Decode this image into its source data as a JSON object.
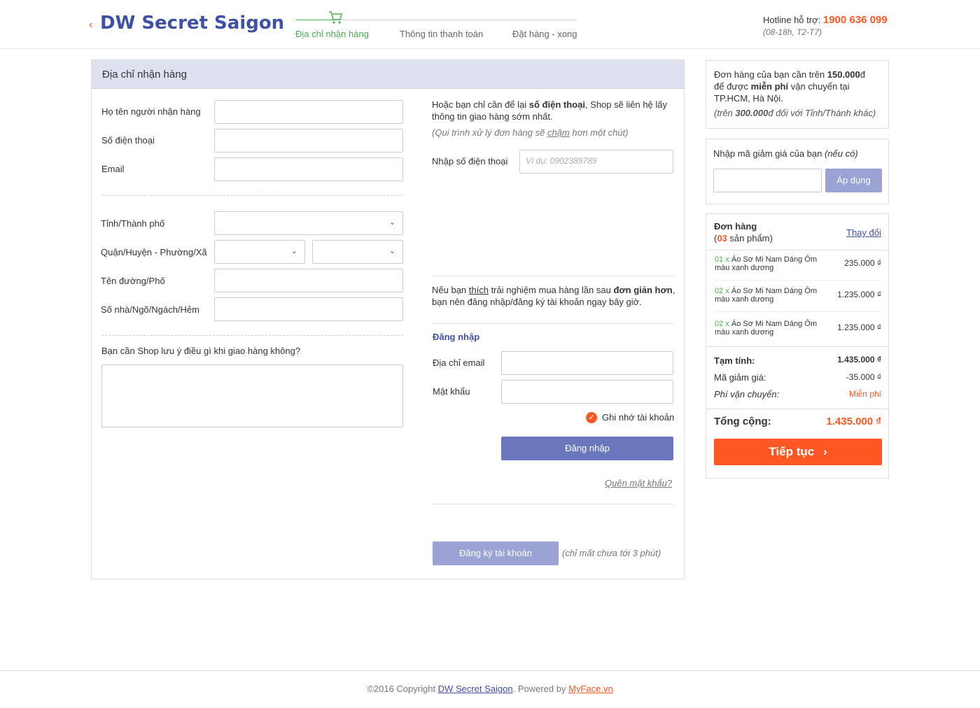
{
  "header": {
    "brand": "DW Secret Saigon",
    "steps": [
      "Địa chỉ nhận hàng",
      "Thông tin thanh toán",
      "Đặt hàng - xong"
    ],
    "hotline_label": "Hotline hỗ trợ:",
    "hotline_number": "1900 636 099",
    "hotline_hours": "(08-18h, T2-T7)"
  },
  "address_section": {
    "title": "Địa chỉ nhận hàng",
    "fields": {
      "name_label": "Họ tên người nhận hàng",
      "phone_label": "Số điện thoại",
      "email_label": "Email",
      "city_label": "Tỉnh/Thành phố",
      "district_label": "Quận/Huyện - Phường/Xã",
      "street_label": "Tên đường/Phố",
      "house_label": "Số nhà/Ngõ/Ngách/Hẻm",
      "note_label": "Bạn cần Shop lưu ý điều gì khi giao hàng không?"
    }
  },
  "quick_phone": {
    "intro_1": "Hoặc bạn chỉ cần để lại ",
    "intro_bold": "số điện thoại",
    "intro_2": ", Shop sẽ liên hệ lấy thông tin giao hàng sớm nhất.",
    "note_1": "(Qui trình xử lý đơn hàng sẽ ",
    "note_u": "chậm",
    "note_2": " hơn một chút)",
    "phone_label": "Nhập số  điện thoại",
    "phone_placeholder": "Ví dụ: 0902389789"
  },
  "login_section": {
    "intro_1": "Nếu bạn ",
    "intro_u": "thích",
    "intro_2": " trải nghiệm mua hàng lần sau ",
    "intro_bold": "đơn giản hơn",
    "intro_3": ",",
    "intro_4": "bạn nên đăng nhập/đăng ký tài khoản ngay bây giờ.",
    "title": "Đăng nhập",
    "email_label": "Địa chỉ email",
    "password_label": "Mật khẩu",
    "remember_label": "Ghi nhớ tài khoản",
    "login_button": "Đăng nhập",
    "forgot_link": "Quên mật khẩu?",
    "register_button": "Đăng ký tài khoản",
    "register_note": "(chỉ mất chưa tới 3 phút)"
  },
  "shipping_info": {
    "line1_a": "Đơn hàng của bạn cần trên ",
    "line1_bold": "150.000",
    "line1_cur": "đ",
    "line2_a": "để được ",
    "line2_bold": "miễn phí",
    "line2_b": " vận chuyển tại",
    "line3": "TP.HCM, Hà Nội.",
    "line4_a": "(trên ",
    "line4_bold": "300.000",
    "line4_b": "đ đối với Tỉnh/Thành khác)"
  },
  "coupon": {
    "label": "Nhập mã giảm giá của bạn ",
    "label_ital": "(nếu có)",
    "apply_button": "Áp dụng"
  },
  "order": {
    "title": "Đơn hàng",
    "count_prefix": "(",
    "count": "03",
    "count_suffix": " sản phẩm)",
    "change_link": "Thay đổi",
    "items": [
      {
        "qty": "01 x",
        "name_1": "Áo Sơ Mi Nam Dáng Ôm",
        "name_2": "màu xanh dương",
        "price": "235.000 ₫"
      },
      {
        "qty": "02 x",
        "name_1": "Áo Sơ Mi Nam Dáng Ôm",
        "name_2": "màu xanh dương",
        "price": "1.235.000 ₫"
      },
      {
        "qty": "02 x",
        "name_1": "Áo Sơ Mi Nam Dáng Ôm",
        "name_2": "màu xanh dương",
        "price": "1.235.000 ₫"
      }
    ],
    "subtotal_label": "Tạm tính:",
    "subtotal_value": "1.435.000 ₫",
    "discount_label": "Mã giảm giá:",
    "discount_value": "-35.000 ₫",
    "shipping_label": "Phí vận chuyển:",
    "shipping_value": "Miễn phí",
    "total_label": "Tổng cộng:",
    "total_value": "1.435.000 ₫",
    "continue_button": "Tiếp tục"
  },
  "footer": {
    "copyright": "©2016 Copyright ",
    "brand": "DW Secret Saigon",
    "powered": ". Powered by ",
    "myface": "MyFace.vn"
  }
}
